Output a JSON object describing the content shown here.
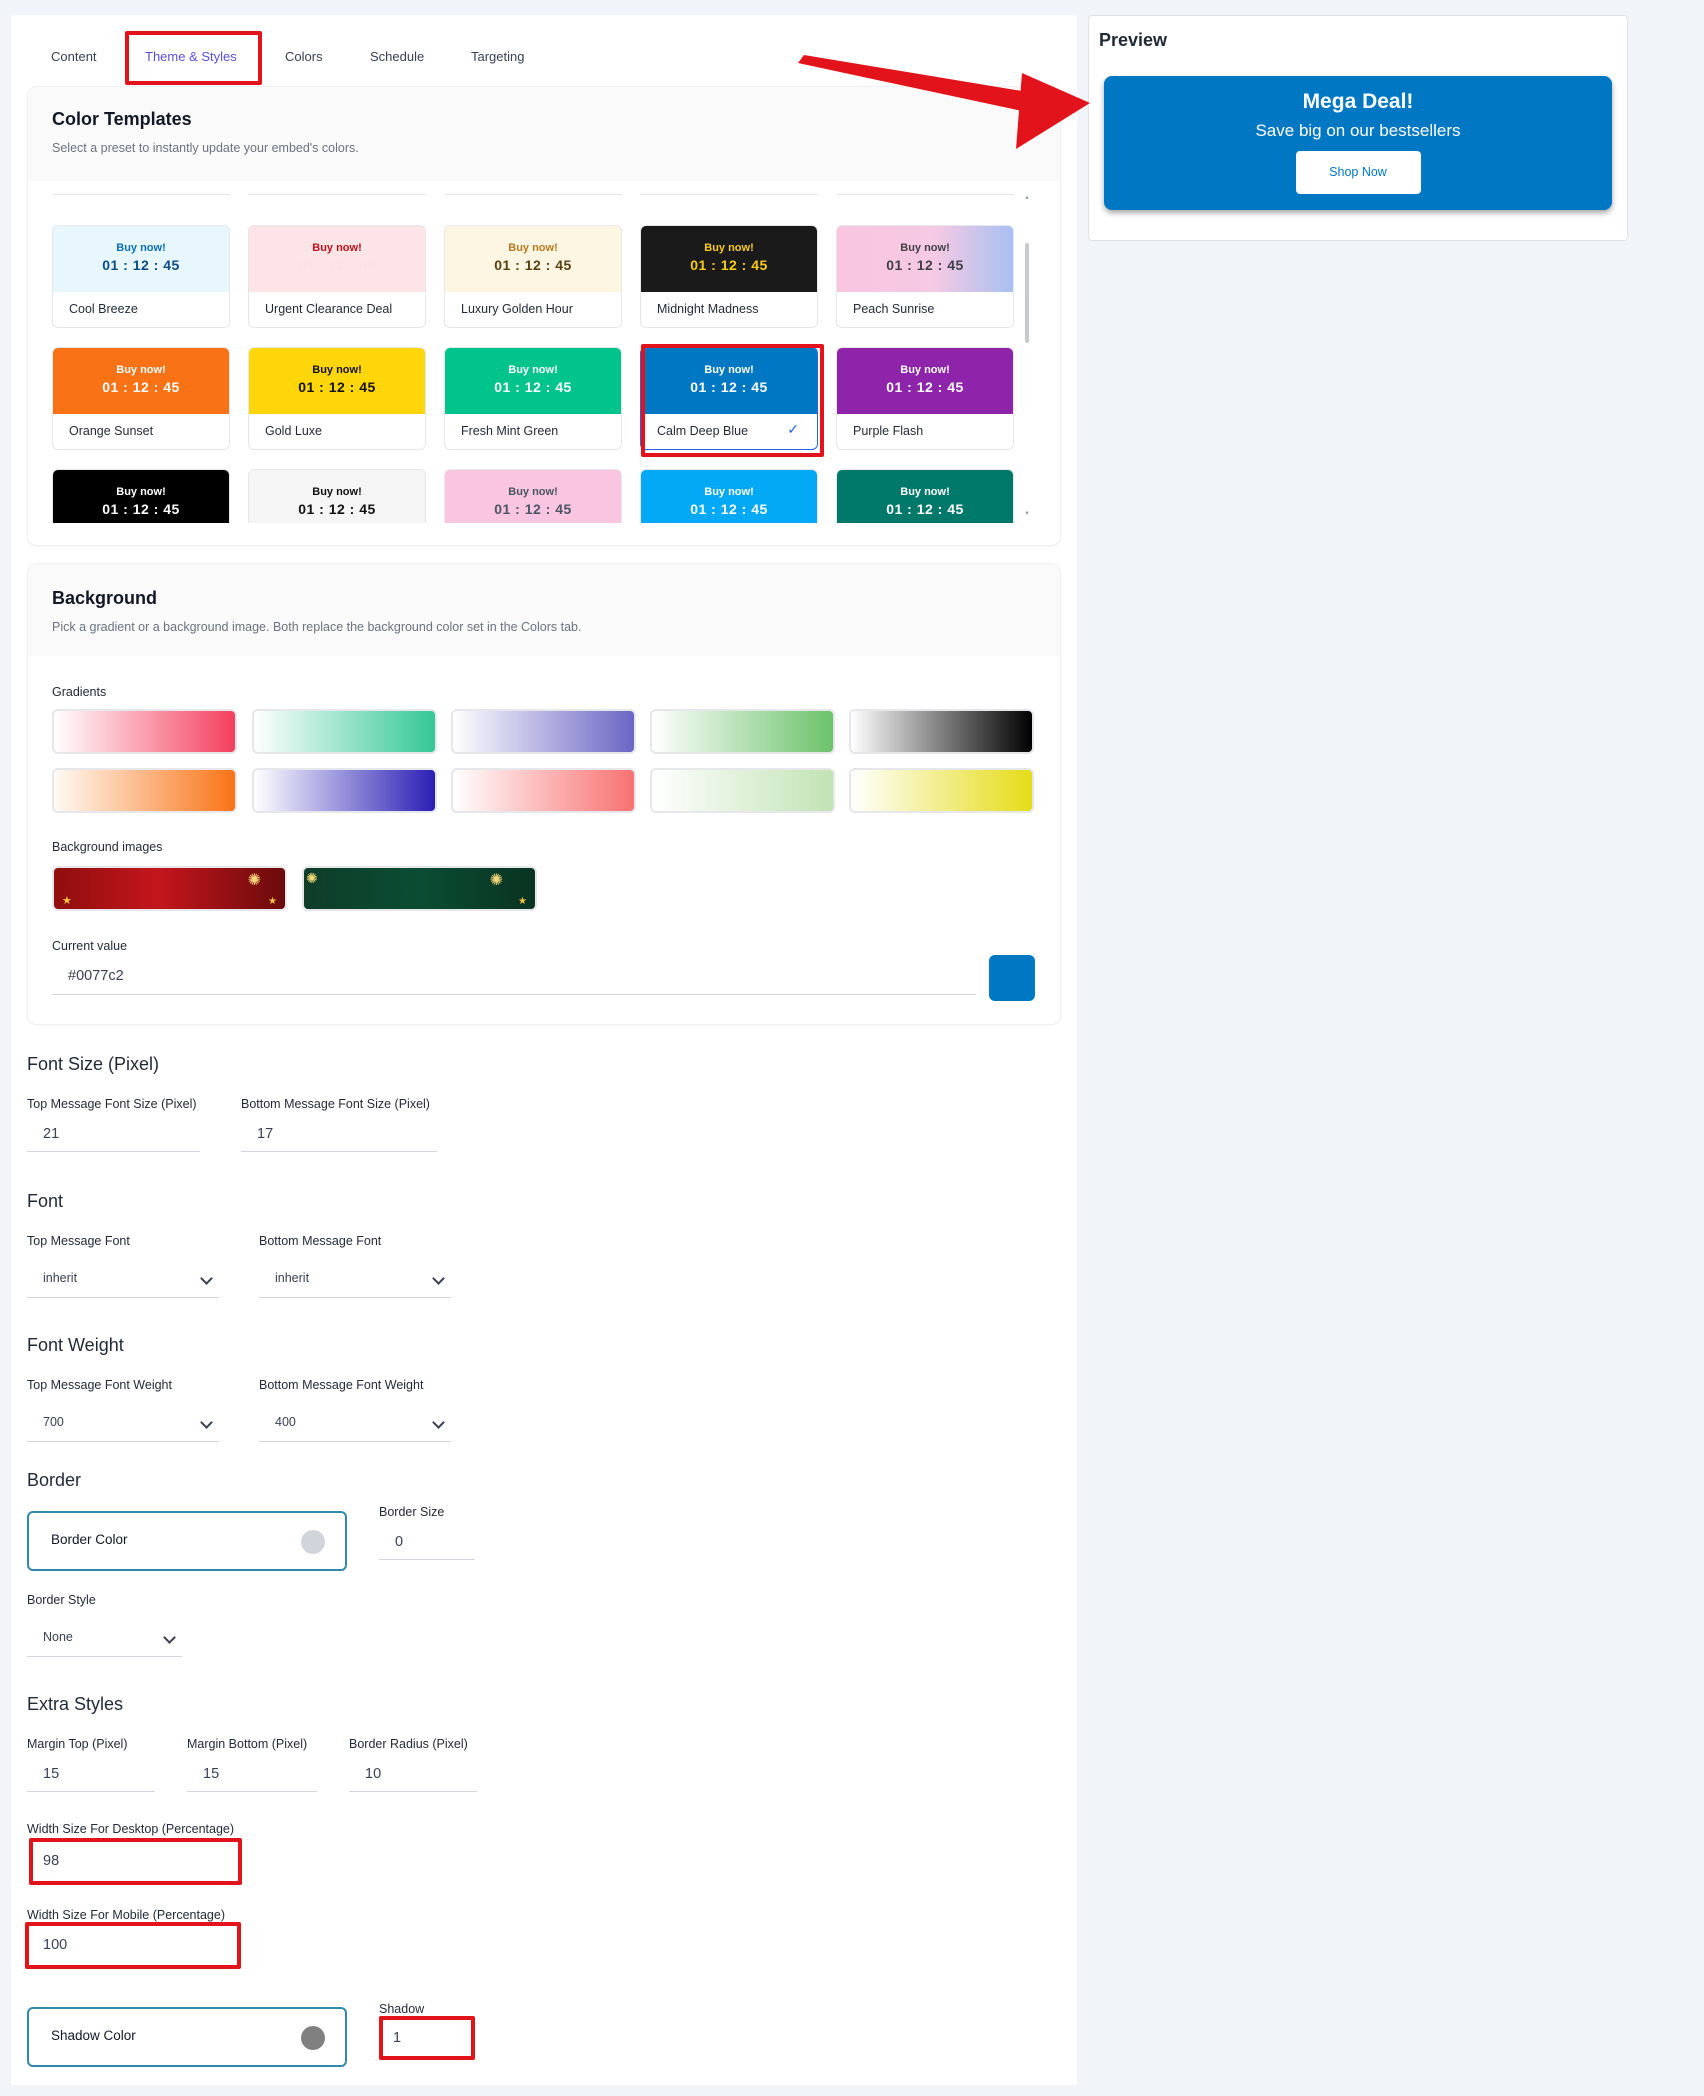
{
  "tabs": [
    "Content",
    "Theme & Styles",
    "Colors",
    "Schedule",
    "Targeting"
  ],
  "color_templates": {
    "title": "Color Templates",
    "subtitle": "Select a preset to instantly update your embed's colors.",
    "buy_label": "Buy now!",
    "time": "01 : 12 : 45",
    "items": [
      {
        "name": "Cool Breeze",
        "bg": "#e8f6fd",
        "buy": "#0a6fb8",
        "time": "#0a4d86"
      },
      {
        "name": "Urgent Clearance Deal",
        "bg": "#fde4e6",
        "buy": "#c0121c",
        "time": "#fbe2e4"
      },
      {
        "name": "Luxury Golden Hour",
        "bg": "#fdf6e3",
        "buy": "#b7791f",
        "time": "#5a4010"
      },
      {
        "name": "Midnight Madness",
        "bg": "#1a1a1a",
        "buy": "#facc15",
        "time": "#facc15"
      },
      {
        "name": "Peach Sunrise",
        "bg": "linear-gradient(90deg,#f9c5e0,#f6c9e4 55%,#a9c0f2)",
        "buy": "#3f3f46",
        "time": "#3f3f46"
      },
      {
        "name": "Orange Sunset",
        "bg": "#f97316",
        "buy": "#ffffff",
        "time": "#ffffff"
      },
      {
        "name": "Gold Luxe",
        "bg": "#ffd60a",
        "buy": "#111111",
        "time": "#111111"
      },
      {
        "name": "Fresh Mint Green",
        "bg": "#00c48c",
        "buy": "#ffffff",
        "time": "#ffffff"
      },
      {
        "name": "Calm Deep Blue",
        "bg": "#0077c2",
        "buy": "#ffffff",
        "time": "#ffffff",
        "selected": true
      },
      {
        "name": "Purple Flash",
        "bg": "#8e24aa",
        "buy": "#ffffff",
        "time": "#ffffff"
      },
      {
        "name": "",
        "bg": "#000000",
        "buy": "#ffffff",
        "time": "#ffffff"
      },
      {
        "name": "",
        "bg": "#f5f5f5",
        "buy": "#111111",
        "time": "#111111"
      },
      {
        "name": "",
        "bg": "#f9c5e0",
        "buy": "#4b5563",
        "time": "#4b5563"
      },
      {
        "name": "",
        "bg": "#03a9f4",
        "buy": "#ffffff",
        "time": "#ffffff"
      },
      {
        "name": "",
        "bg": "#00796b",
        "buy": "#ffffff",
        "time": "#ffffff"
      }
    ]
  },
  "background": {
    "title": "Background",
    "subtitle": "Pick a gradient or a background image. Both replace the background color set in the Colors tab.",
    "gradients_label": "Gradients",
    "gradients": [
      "linear-gradient(90deg,#ffffff,#f43f5e)",
      "linear-gradient(90deg,#ffffff,#34c796)",
      "linear-gradient(90deg,#ffffff,#6b66c4)",
      "linear-gradient(90deg,#ffffff,#6cc26a)",
      "linear-gradient(90deg,#ffffff,#000000)",
      "linear-gradient(90deg,#fffaf5,#f97316)",
      "linear-gradient(90deg,#ffffff,#2a1fb5)",
      "linear-gradient(90deg,#ffffff,#f87171)",
      "linear-gradient(90deg,#ffffff,#c1e3b4)",
      "linear-gradient(90deg,#ffffff,#e5dc17)"
    ],
    "images_label": "Background images",
    "images": [
      "linear-gradient(90deg,#8f0e0e,#c4161c 45%,#6b0b0b)",
      "linear-gradient(90deg,#0e3d29,#0b4d32 50%,#0a3322)"
    ],
    "current_label": "Current value",
    "current_value": "#0077c2",
    "current_color": "#0077c2"
  },
  "font_size": {
    "title": "Font Size (Pixel)",
    "top_label": "Top Message Font Size (Pixel)",
    "top_value": "21",
    "bottom_label": "Bottom Message Font Size (Pixel)",
    "bottom_value": "17"
  },
  "font": {
    "title": "Font",
    "top_label": "Top Message Font",
    "top_value": "inherit",
    "bottom_label": "Bottom Message Font",
    "bottom_value": "inherit"
  },
  "font_weight": {
    "title": "Font Weight",
    "top_label": "Top Message Font Weight",
    "top_value": "700",
    "bottom_label": "Bottom Message Font Weight",
    "bottom_value": "400"
  },
  "border": {
    "title": "Border",
    "color_label": "Border Color",
    "color_value": "#d1d5db",
    "size_label": "Border Size",
    "size_value": "0",
    "style_label": "Border Style",
    "style_value": "None"
  },
  "extra": {
    "title": "Extra Styles",
    "margin_top_label": "Margin Top (Pixel)",
    "margin_top_value": "15",
    "margin_bottom_label": "Margin Bottom (Pixel)",
    "margin_bottom_value": "15",
    "radius_label": "Border Radius (Pixel)",
    "radius_value": "10",
    "desktop_label": "Width Size For Desktop (Percentage)",
    "desktop_value": "98",
    "mobile_label": "Width Size For Mobile (Percentage)",
    "mobile_value": "100",
    "shadow_color_label": "Shadow Color",
    "shadow_color_value": "#808080",
    "shadow_label": "Shadow",
    "shadow_value": "1"
  },
  "preview": {
    "title": "Preview",
    "top_message": "Mega Deal!",
    "bottom_message": "Save big on our bestsellers",
    "button": "Shop Now",
    "bg_color": "#0077c2"
  },
  "annotation_color": "#e3131b"
}
